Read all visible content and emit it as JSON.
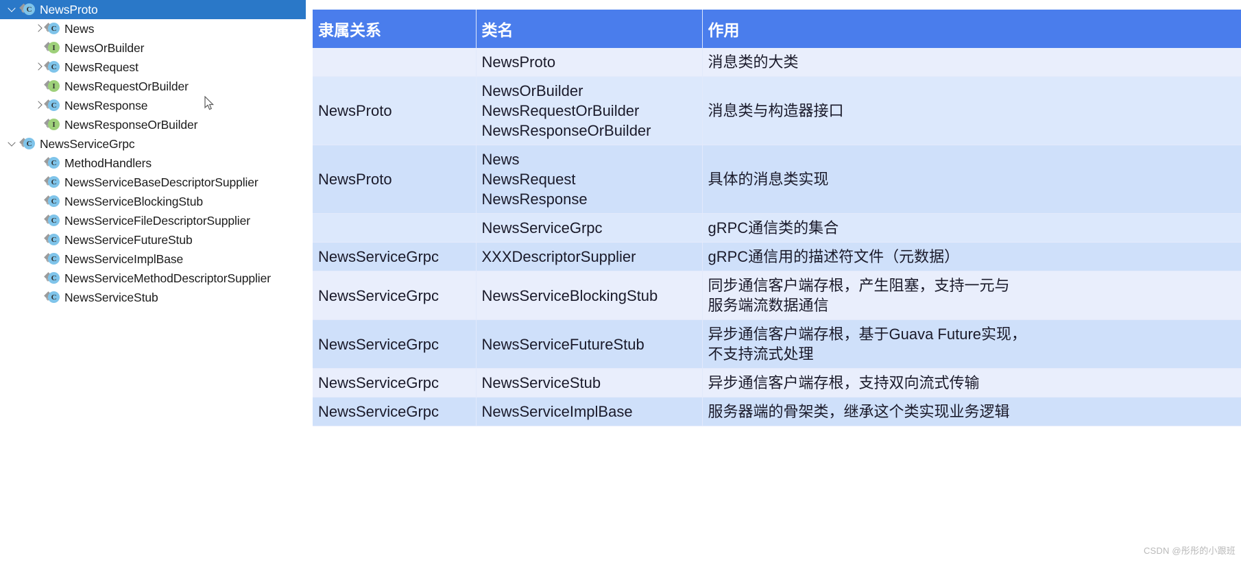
{
  "tree": {
    "items": [
      {
        "label": "NewsProto",
        "indent": 0,
        "twisty": "down",
        "icon": "class-icon",
        "selected": true
      },
      {
        "label": "News",
        "indent": 1,
        "twisty": "right",
        "icon": "class-icon",
        "selected": false
      },
      {
        "label": "NewsOrBuilder",
        "indent": 1,
        "twisty": "none",
        "icon": "interface-icon",
        "selected": false
      },
      {
        "label": "NewsRequest",
        "indent": 1,
        "twisty": "right",
        "icon": "class-icon",
        "selected": false
      },
      {
        "label": "NewsRequestOrBuilder",
        "indent": 1,
        "twisty": "none",
        "icon": "interface-icon",
        "selected": false
      },
      {
        "label": "NewsResponse",
        "indent": 1,
        "twisty": "right",
        "icon": "class-icon",
        "selected": false
      },
      {
        "label": "NewsResponseOrBuilder",
        "indent": 1,
        "twisty": "none",
        "icon": "interface-icon",
        "selected": false
      },
      {
        "label": "NewsServiceGrpc",
        "indent": 0,
        "twisty": "down",
        "icon": "class-icon",
        "selected": false
      },
      {
        "label": "MethodHandlers",
        "indent": 1,
        "twisty": "none",
        "icon": "class-icon",
        "selected": false
      },
      {
        "label": "NewsServiceBaseDescriptorSupplier",
        "indent": 1,
        "twisty": "none",
        "icon": "class-icon",
        "selected": false
      },
      {
        "label": "NewsServiceBlockingStub",
        "indent": 1,
        "twisty": "none",
        "icon": "class-icon",
        "selected": false
      },
      {
        "label": "NewsServiceFileDescriptorSupplier",
        "indent": 1,
        "twisty": "none",
        "icon": "class-icon",
        "selected": false
      },
      {
        "label": "NewsServiceFutureStub",
        "indent": 1,
        "twisty": "none",
        "icon": "class-icon",
        "selected": false
      },
      {
        "label": "NewsServiceImplBase",
        "indent": 1,
        "twisty": "none",
        "icon": "class-icon",
        "selected": false
      },
      {
        "label": "NewsServiceMethodDescriptorSupplier",
        "indent": 1,
        "twisty": "none",
        "icon": "class-icon",
        "selected": false
      },
      {
        "label": "NewsServiceStub",
        "indent": 1,
        "twisty": "none",
        "icon": "class-icon",
        "selected": false
      }
    ],
    "icon_letters": {
      "class-icon": "C",
      "interface-icon": "I"
    }
  },
  "table": {
    "headers": [
      "隶属关系",
      "类名",
      "作用"
    ],
    "rows": [
      {
        "owner": "",
        "classname": "NewsProto",
        "role": "消息类的大类",
        "band": "band-b"
      },
      {
        "owner": "NewsProto",
        "classname": "NewsOrBuilder\nNewsRequestOrBuilder\nNewsResponseOrBuilder",
        "role": "消息类与构造器接口",
        "band": "band-c"
      },
      {
        "owner": "NewsProto",
        "classname": "News\nNewsRequest\nNewsResponse",
        "role": "具体的消息类实现",
        "band": "band-a"
      },
      {
        "owner": "",
        "classname": "NewsServiceGrpc",
        "role": "gRPC通信类的集合",
        "band": "band-c"
      },
      {
        "owner": "NewsServiceGrpc",
        "classname": "XXXDescriptorSupplier",
        "role": "gRPC通信用的描述符文件（元数据）",
        "band": "band-a"
      },
      {
        "owner": "NewsServiceGrpc",
        "classname": "NewsServiceBlockingStub",
        "role": "同步通信客户端存根，产生阻塞，支持一元与\n服务端流数据通信",
        "band": "band-b"
      },
      {
        "owner": "NewsServiceGrpc",
        "classname": "NewsServiceFutureStub",
        "role": "异步通信客户端存根，基于Guava Future实现，\n不支持流式处理",
        "band": "band-a"
      },
      {
        "owner": "NewsServiceGrpc",
        "classname": "NewsServiceStub",
        "role": "异步通信客户端存根，支持双向流式传输",
        "band": "band-b"
      },
      {
        "owner": "NewsServiceGrpc",
        "classname": "NewsServiceImplBase",
        "role": "服务器端的骨架类，继承这个类实现业务逻辑",
        "band": "band-a"
      }
    ]
  },
  "watermark": "CSDN @彤彤的小跟班",
  "colors": {
    "header_blue": "#4a7dec",
    "selection_blue": "#2a78c8",
    "band_a": "#cfe0fa",
    "band_b": "#e9eefc",
    "band_c": "#dce8fc"
  }
}
